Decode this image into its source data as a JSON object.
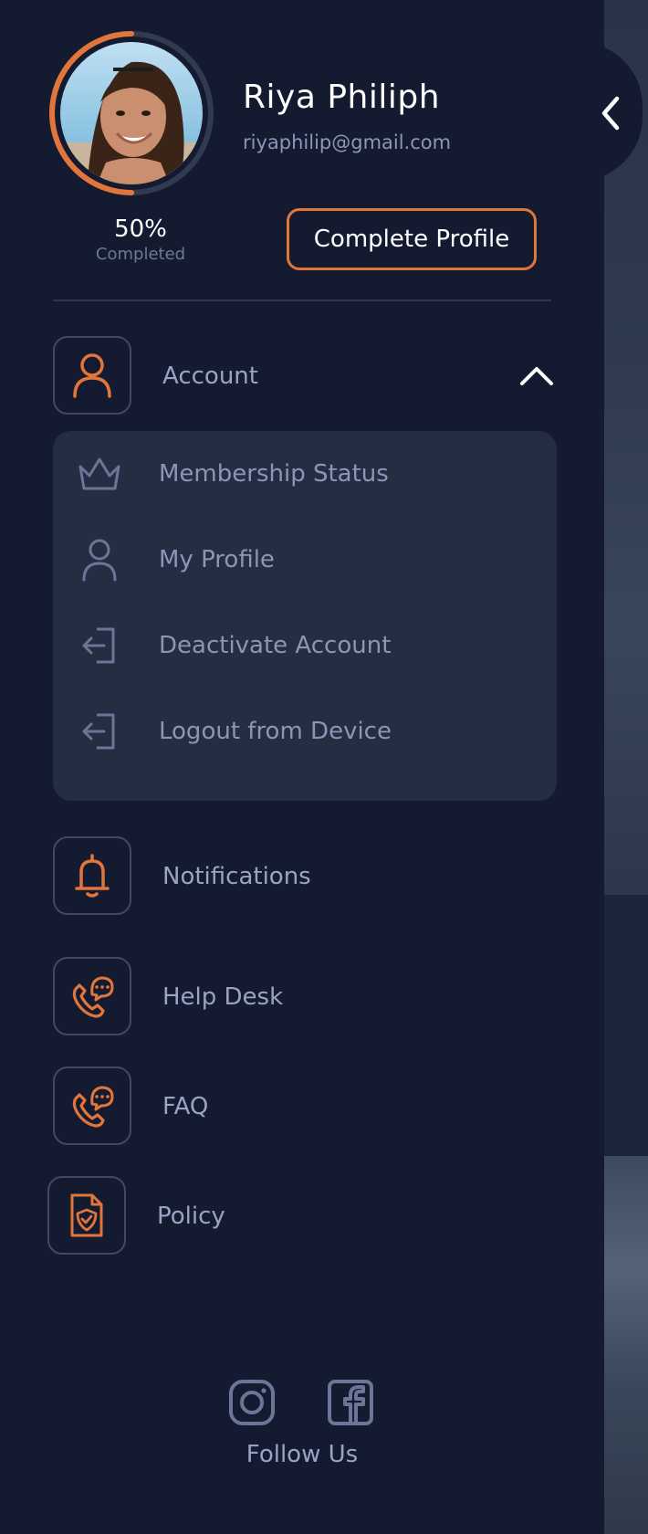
{
  "user": {
    "name": "Riya Philiph",
    "email": "riyaphilip@gmail.com"
  },
  "profile_progress": {
    "percent_label": "50%",
    "caption": "Completed",
    "value": 0.5
  },
  "complete_profile_button": "Complete Profile",
  "menu": {
    "account": {
      "label": "Account",
      "icon": "user-icon",
      "expanded": true,
      "items": [
        {
          "label": "Membership Status",
          "icon": "crown-icon"
        },
        {
          "label": "My Profile",
          "icon": "user-icon"
        },
        {
          "label": "Deactivate Account",
          "icon": "exit-icon"
        },
        {
          "label": "Logout from Device",
          "icon": "exit-icon"
        }
      ]
    },
    "notifications": {
      "label": "Notifications",
      "icon": "bell-icon"
    },
    "help_desk": {
      "label": "Help Desk",
      "icon": "phone-chat-icon"
    },
    "faq": {
      "label": "FAQ",
      "icon": "phone-chat-icon"
    },
    "policy": {
      "label": "Policy",
      "icon": "shield-document-icon"
    }
  },
  "footer": {
    "follow_label": "Follow Us",
    "socials": [
      "instagram-icon",
      "facebook-icon"
    ]
  },
  "colors": {
    "background": "#141b30",
    "accent": "#e2763a",
    "submenu_bg": "#252d42",
    "text_muted": "#9aa3c4",
    "border": "#414a60"
  }
}
